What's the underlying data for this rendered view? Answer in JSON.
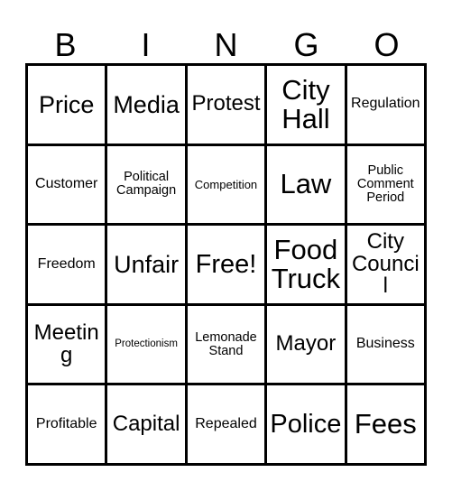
{
  "card": {
    "type": "bingo-card",
    "columns": 5,
    "rows": 5,
    "background_color": "#ffffff",
    "line_color": "#000000",
    "text_color": "#000000"
  },
  "header": {
    "letters": [
      {
        "label": "B"
      },
      {
        "label": "I"
      },
      {
        "label": "N"
      },
      {
        "label": "G"
      },
      {
        "label": "O"
      }
    ]
  },
  "grid": {
    "cells": [
      {
        "label": "Price",
        "size": "fs-l"
      },
      {
        "label": "Media",
        "size": "fs-l"
      },
      {
        "label": "Protest",
        "size": "fs-m"
      },
      {
        "label": "City Hall",
        "size": "fs-xxl"
      },
      {
        "label": "Regulation",
        "size": "fs-s"
      },
      {
        "label": "Customer",
        "size": "fs-s"
      },
      {
        "label": "Political Campaign",
        "size": "fs-xs"
      },
      {
        "label": "Competition",
        "size": "fs-xxs"
      },
      {
        "label": "Law",
        "size": "fs-xxl"
      },
      {
        "label": "Public Comment Period",
        "size": "fs-xs"
      },
      {
        "label": "Freedom",
        "size": "fs-s"
      },
      {
        "label": "Unfair",
        "size": "fs-l"
      },
      {
        "label": "Free!",
        "size": "fs-xl"
      },
      {
        "label": "Food Truck",
        "size": "fs-xxl"
      },
      {
        "label": "City Council",
        "size": "fs-m"
      },
      {
        "label": "Meeting",
        "size": "fs-m"
      },
      {
        "label": "Protectionism",
        "size": "fs-tiny"
      },
      {
        "label": "Lemonade Stand",
        "size": "fs-xs"
      },
      {
        "label": "Mayor",
        "size": "fs-m"
      },
      {
        "label": "Business",
        "size": "fs-s"
      },
      {
        "label": "Profitable",
        "size": "fs-s"
      },
      {
        "label": "Capital",
        "size": "fs-m"
      },
      {
        "label": "Repealed",
        "size": "fs-s"
      },
      {
        "label": "Police",
        "size": "fs-xl"
      },
      {
        "label": "Fees",
        "size": "fs-xxl"
      }
    ]
  }
}
